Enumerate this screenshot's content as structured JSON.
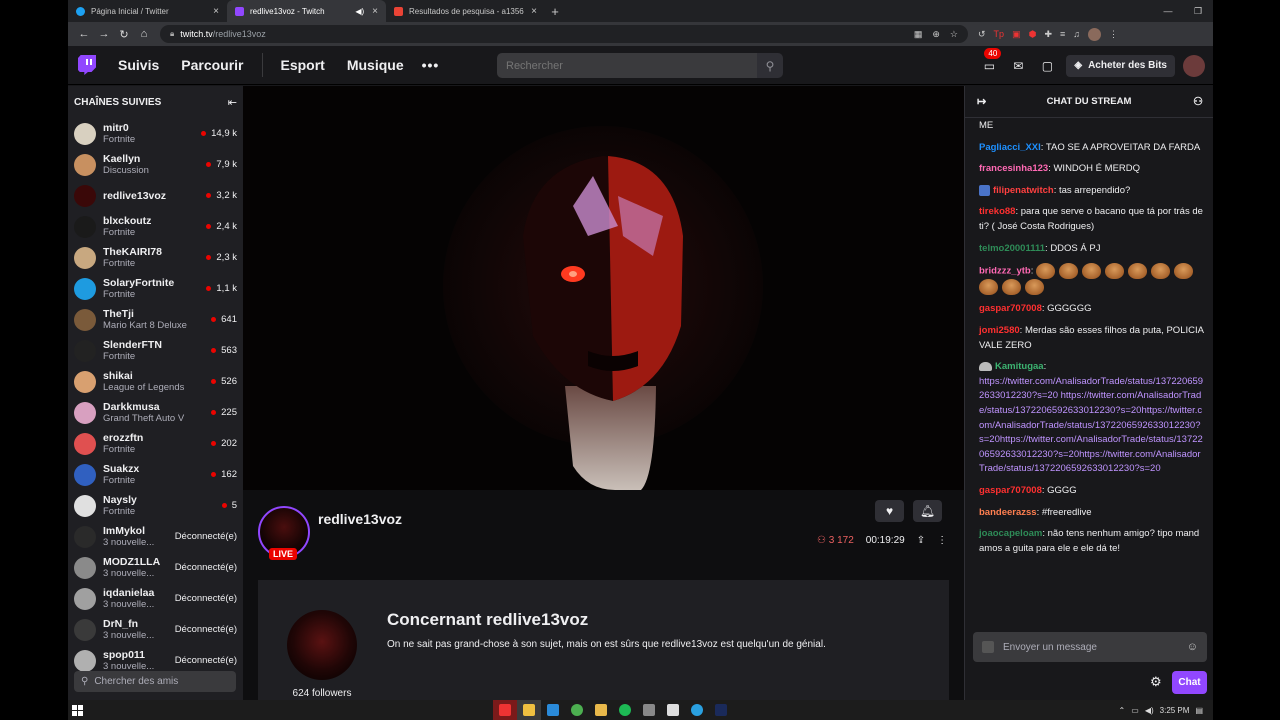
{
  "browser": {
    "tabs": [
      {
        "title": "Página Inicial / Twitter",
        "icon": "twitter-icon",
        "color": "#1da1f2"
      },
      {
        "title": "redlive13voz - Twitch",
        "icon": "twitch-icon",
        "color": "#9147ff",
        "active": true
      },
      {
        "title": "Resultados de pesquisa - a1356",
        "icon": "gmail-icon",
        "color": "#ea4335"
      }
    ],
    "url_host": "twitch.tv",
    "url_path": "/redlive13voz"
  },
  "nav": {
    "links": [
      "Suivis",
      "Parcourir",
      "Esport",
      "Musique"
    ],
    "more": "•••",
    "search_placeholder": "Rechercher",
    "notifications_count": "40",
    "bits_label": "Acheter des Bits"
  },
  "sidebar": {
    "title": "CHAÎNES SUIVIES",
    "channels": [
      {
        "name": "mitr0",
        "game": "Fortnite",
        "viewers": "14,9 k",
        "live": true,
        "color": "#d8d0c0"
      },
      {
        "name": "Kaellyn",
        "game": "Discussion",
        "viewers": "7,9 k",
        "live": true,
        "color": "#c89060"
      },
      {
        "name": "redlive13voz",
        "game": "",
        "viewers": "3,2 k",
        "live": true,
        "color": "#3a0808"
      },
      {
        "name": "blxckoutz",
        "game": "Fortnite",
        "viewers": "2,4 k",
        "live": true,
        "color": "#1a1a1a"
      },
      {
        "name": "TheKAIRI78",
        "game": "Fortnite",
        "viewers": "2,3 k",
        "live": true,
        "color": "#c8a880"
      },
      {
        "name": "SolaryFortnite",
        "game": "Fortnite",
        "viewers": "1,1 k",
        "live": true,
        "color": "#1e9be0"
      },
      {
        "name": "TheTji",
        "game": "Mario Kart 8 Deluxe",
        "viewers": "641",
        "live": true,
        "color": "#7a5a3a"
      },
      {
        "name": "SlenderFTN",
        "game": "Fortnite",
        "viewers": "563",
        "live": true,
        "color": "#222"
      },
      {
        "name": "shikai",
        "game": "League of Legends",
        "viewers": "526",
        "live": true,
        "color": "#d8a070"
      },
      {
        "name": "Darkkmusa",
        "game": "Grand Theft Auto V",
        "viewers": "225",
        "live": true,
        "color": "#d8a0c0"
      },
      {
        "name": "erozzftn",
        "game": "Fortnite",
        "viewers": "202",
        "live": true,
        "color": "#e05050"
      },
      {
        "name": "Suakzx",
        "game": "Fortnite",
        "viewers": "162",
        "live": true,
        "color": "#3060c0"
      },
      {
        "name": "Naysly",
        "game": "Fortnite",
        "viewers": "5",
        "live": true,
        "color": "#e0e0e0"
      },
      {
        "name": "ImMykol",
        "game": "3 nouvelle...",
        "status": "Déconnecté(e)",
        "live": false,
        "color": "#2a2a2a"
      },
      {
        "name": "MODZ1LLA",
        "game": "3 nouvelle...",
        "status": "Déconnecté(e)",
        "live": false,
        "color": "#8a8a8a"
      },
      {
        "name": "iqdanielaa",
        "game": "3 nouvelle...",
        "status": "Déconnecté(e)",
        "live": false,
        "color": "#a0a0a0"
      },
      {
        "name": "DrN_fn",
        "game": "3 nouvelle...",
        "status": "Déconnecté(e)",
        "live": false,
        "color": "#3a3a3a"
      },
      {
        "name": "spop011",
        "game": "3 nouvelle...",
        "status": "Déconnecté(e)",
        "live": false,
        "color": "#b0b0b0"
      }
    ],
    "search_placeholder": "Chercher des amis"
  },
  "channel": {
    "name": "redlive13voz",
    "live_label": "LIVE",
    "viewers": "3 172",
    "uptime": "00:19:29",
    "about_title": "Concernant redlive13voz",
    "about_desc": "On ne sait pas grand-chose à son sujet, mais on est sûrs que redlive13voz est quelqu'un de génial.",
    "followers": "624 followers"
  },
  "chat": {
    "title": "CHAT DU STREAM",
    "messages": [
      {
        "user": "",
        "color": "#efeff1",
        "text": "ME"
      },
      {
        "user": "Pagliacci_XXI",
        "color": "#1e90ff",
        "text": ": TAO SE A APROVEITAR DA FARDA"
      },
      {
        "user": "francesinha123",
        "color": "#ff69b4",
        "text": ": WINDOH É MERDQ"
      },
      {
        "user": "filipenatwitch",
        "color": "#ff4040",
        "text": ": tas arrependido?",
        "badge": "square"
      },
      {
        "user": "tireko88",
        "color": "#ff3030",
        "text": ": para que serve o bacano que tá por trás de ti? ( José Costa Rodrigues)"
      },
      {
        "user": "telmo20001111",
        "color": "#2e8b57",
        "text": ": DDOS Á PJ"
      },
      {
        "user": "bridzzz_ytb",
        "color": "#ff69b4",
        "text": ":",
        "emotes": 10
      },
      {
        "user": "gaspar707008",
        "color": "#ff3030",
        "text": ": GGGGGG"
      },
      {
        "user": "jomi2580",
        "color": "#ff3030",
        "text": ": Merdas são esses filhos da puta, POLICIA VALE ZERO"
      },
      {
        "user": "Kamitugaa",
        "color": "#3cb371",
        "text": ":",
        "badge": "cap",
        "link": "https://twitter.com/AnalisadorTrade/status/1372206592633012230?s=20 https://twitter.com/AnalisadorTrade/status/1372206592633012230?s=20https://twitter.com/AnalisadorTrade/status/1372206592633012230?s=20https://twitter.com/AnalisadorTrade/status/1372206592633012230?s=20https://twitter.com/AnalisadorTrade/status/1372206592633012230?s=20"
      },
      {
        "user": "gaspar707008",
        "color": "#ff3030",
        "text": ": GGGG"
      },
      {
        "user": "bandeerazss",
        "color": "#ff7f50",
        "text": ": #freeredlive"
      },
      {
        "user": "joaocapeloam",
        "color": "#2e8b57",
        "text": ": não tens nenhum amigo? tipo mandamos a guita para ele e ele dá te!"
      }
    ],
    "input_placeholder": "Envoyer un message",
    "send_label": "Chat"
  },
  "taskbar": {
    "time": "3:25 PM"
  }
}
